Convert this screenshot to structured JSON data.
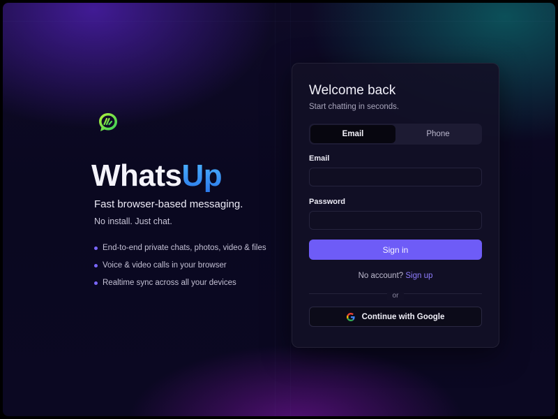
{
  "brand": {
    "name_part1": "Whats",
    "name_part2": "Up",
    "tagline": "Fast browser-based messaging.",
    "subtagline": "No install. Just chat.",
    "logo_icon": "chat-bubble-logo-icon",
    "features": [
      "End-to-end private chats, photos, video & files",
      "Voice & video calls in your browser",
      "Realtime sync across all your devices"
    ]
  },
  "login": {
    "title": "Welcome back",
    "subtitle": "Start chatting in seconds.",
    "tabs": [
      {
        "label": "Email",
        "active": true
      },
      {
        "label": "Phone",
        "active": false
      }
    ],
    "email_label": "Email",
    "email_value": "",
    "email_placeholder": "",
    "password_label": "Password",
    "password_value": "",
    "password_placeholder": "",
    "signin_label": "Sign in",
    "no_account_text": "No account?",
    "signup_link": "Sign up",
    "divider_text": "or",
    "google_label": "Continue with Google",
    "google_icon": "google-icon"
  },
  "colors": {
    "accent": "#6e5cf7",
    "link": "#8f7dff",
    "logo_green": "#7be34a",
    "brand_blue": "#2a8cf0"
  }
}
